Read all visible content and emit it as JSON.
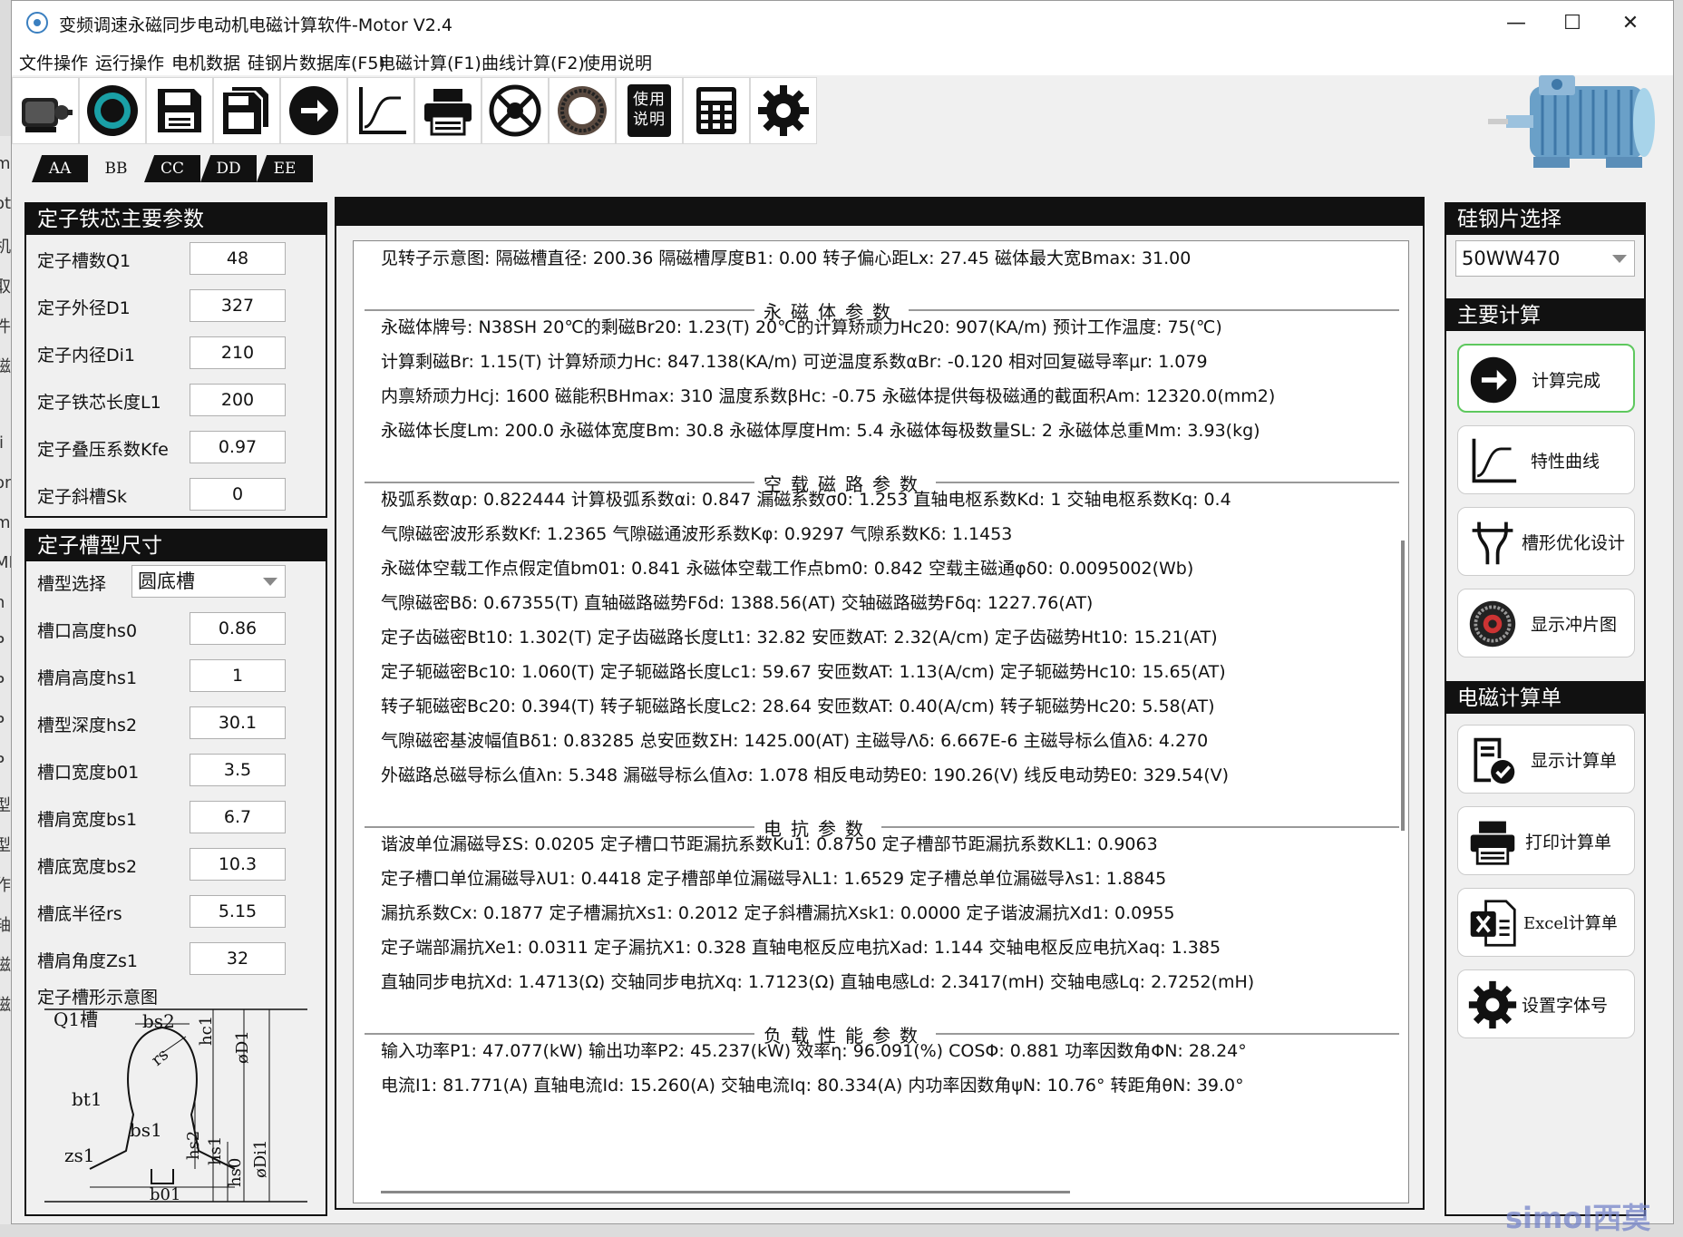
{
  "window": {
    "title": "变频调速永磁同步电动机电磁计算软件-Motor V2.4",
    "controls": [
      "—",
      "☐",
      "✕"
    ]
  },
  "menu": [
    "文件操作",
    "运行操作",
    "电机数据",
    "硅钢片数据库(F5)",
    "电磁计算(F1)",
    "曲线计算(F2)",
    "使用说明"
  ],
  "toolbar": {
    "icons": [
      "motor-icon",
      "stator-core-icon",
      "save-icon",
      "save-as-icon",
      "arrow-right-icon",
      "curve-icon",
      "printer-icon",
      "rotor-icon",
      "ring-icon",
      "manual-icon",
      "calculator-icon",
      "gear-icon"
    ],
    "manual_text": "使用说明"
  },
  "tabs": [
    "AA",
    "BB",
    "CC",
    "DD",
    "EE"
  ],
  "stator_core": {
    "title": "定子铁芯主要参数",
    "rows": [
      {
        "label": "定子槽数Q1",
        "value": "48"
      },
      {
        "label": "定子外径D1",
        "value": "327"
      },
      {
        "label": "定子内径Di1",
        "value": "210"
      },
      {
        "label": "定子铁芯长度L1",
        "value": "200"
      },
      {
        "label": "定子叠压系数Kfe",
        "value": "0.97"
      },
      {
        "label": "定子斜槽Sk",
        "value": "0"
      }
    ]
  },
  "slot": {
    "title": "定子槽型尺寸",
    "type_label": "槽型选择",
    "type_value": "圆底槽",
    "rows": [
      {
        "label": "槽口高度hs0",
        "value": "0.86"
      },
      {
        "label": "槽肩高度hs1",
        "value": "1"
      },
      {
        "label": "槽型深度hs2",
        "value": "30.1"
      },
      {
        "label": "槽口宽度b01",
        "value": "3.5"
      },
      {
        "label": "槽肩宽度bs1",
        "value": "6.7"
      },
      {
        "label": "槽底宽度bs2",
        "value": "10.3"
      },
      {
        "label": "槽底半径rs",
        "value": "5.15"
      },
      {
        "label": "槽肩角度Zs1",
        "value": "32"
      }
    ],
    "diagram_title": "定子槽形示意图",
    "diagram_labels": [
      "Q1槽",
      "bs2",
      "hc1",
      "øD1",
      "rs",
      "bt1",
      "bs1",
      "hs2",
      "hs1",
      "hs0",
      "øDi1",
      "zs1",
      "b01"
    ]
  },
  "results": {
    "lines": [
      {
        "type": "text",
        "text": "见转子示意图: 隔磁槽直径: 200.36 隔磁槽厚度B1: 0.00 转子偏心距Lx: 27.45 磁体最大宽Bmax: 31.00"
      },
      {
        "type": "section",
        "text": "永磁体参数"
      },
      {
        "type": "text",
        "text": "永磁体牌号: N38SH 20℃的剩磁Br20: 1.23(T) 20℃的计算矫顽力Hc20: 907(KA/m) 预计工作温度: 75(℃)"
      },
      {
        "type": "text",
        "text": "计算剩磁Br: 1.15(T) 计算矫顽力Hc: 847.138(KA/m) 可逆温度系数αBr: -0.120 相对回复磁导率μr: 1.079"
      },
      {
        "type": "text",
        "text": "内禀矫顽力Hcj: 1600 磁能积BHmax: 310 温度系数βHc: -0.75 永磁体提供每极磁通的截面积Am: 12320.0(mm2)"
      },
      {
        "type": "text",
        "text": "永磁体长度Lm: 200.0 永磁体宽度Bm: 30.8 永磁体厚度Hm: 5.4 永磁体每极数量SL: 2 永磁体总重Mm: 3.93(kg)"
      },
      {
        "type": "section",
        "text": "空载磁路参数"
      },
      {
        "type": "text",
        "text": "极弧系数αp: 0.822444 计算极弧系数αi: 0.847 漏磁系数σ0: 1.253 直轴电枢系数Kd: 1 交轴电枢系数Kq: 0.4"
      },
      {
        "type": "text",
        "text": "气隙磁密波形系数Kf: 1.2365 气隙磁通波形系数Kφ: 0.9297 气隙系数Kδ: 1.1453"
      },
      {
        "type": "text",
        "text": "永磁体空载工作点假定值bm01: 0.841 永磁体空载工作点bm0: 0.842 空载主磁通φδ0: 0.0095002(Wb)"
      },
      {
        "type": "text",
        "text": "气隙磁密Bδ: 0.67355(T) 直轴磁路磁势Fδd: 1388.56(AT) 交轴磁路磁势Fδq: 1227.76(AT)"
      },
      {
        "type": "text",
        "text": "定子齿磁密Bt10: 1.302(T) 定子齿磁路长度Lt1: 32.82 安匝数AT: 2.32(A/cm) 定子齿磁势Ht10: 15.21(AT)"
      },
      {
        "type": "text",
        "text": "定子轭磁密Bc10: 1.060(T) 定子轭磁路长度Lc1: 59.67 安匝数AT: 1.13(A/cm) 定子轭磁势Hc10: 15.65(AT)"
      },
      {
        "type": "text",
        "text": "转子轭磁密Bc20: 0.394(T) 转子轭磁路长度Lc2: 28.64 安匝数AT: 0.40(A/cm) 转子轭磁势Hc20: 5.58(AT)"
      },
      {
        "type": "text",
        "text": "气隙磁密基波幅值Bδ1: 0.83285 总安匝数ΣH: 1425.00(AT) 主磁导Λδ: 6.667E-6 主磁导标么值λδ: 4.270"
      },
      {
        "type": "text",
        "text": "外磁路总磁导标么值λn: 5.348 漏磁导标么值λσ: 1.078 相反电动势E0: 190.26(V) 线反电动势E0: 329.54(V)"
      },
      {
        "type": "section",
        "text": "电抗参数"
      },
      {
        "type": "text",
        "text": "谐波单位漏磁导ΣS: 0.0205 定子槽口节距漏抗系数Ku1: 0.8750 定子槽部节距漏抗系数KL1: 0.9063"
      },
      {
        "type": "text",
        "text": "定子槽口单位漏磁导λU1: 0.4418 定子槽部单位漏磁导λL1: 1.6529 定子槽总单位漏磁导λs1: 1.8845"
      },
      {
        "type": "text",
        "text": "漏抗系数Cx: 0.1877 定子槽漏抗Xs1: 0.2012 定子斜槽漏抗Xsk1: 0.0000 定子谐波漏抗Xd1: 0.0955"
      },
      {
        "type": "text",
        "text": "定子端部漏抗Xe1: 0.0311 定子漏抗X1: 0.328 直轴电枢反应电抗Xad: 1.144 交轴电枢反应电抗Xaq: 1.385"
      },
      {
        "type": "text",
        "text": "直轴同步电抗Xd: 1.4713(Ω) 交轴同步电抗Xq: 1.7123(Ω) 直轴电感Ld: 2.3417(mH) 交轴电感Lq: 2.7252(mH)"
      },
      {
        "type": "section",
        "text": "负载性能参数"
      },
      {
        "type": "text",
        "text": "输入功率P1: 47.077(kW) 输出功率P2: 45.237(kW) 效率η: 96.091(%) COSΦ: 0.881 功率因数角ΦN: 28.24°"
      },
      {
        "type": "text",
        "text": "电流I1: 81.771(A) 直轴电流Id: 15.260(A) 交轴电流Iq: 80.334(A) 内功率因数角ψN: 10.76° 转距角θN: 39.0°"
      }
    ]
  },
  "steel": {
    "title": "硅钢片选择",
    "value": "50WW470"
  },
  "main_calc": {
    "title": "主要计算",
    "buttons": [
      {
        "label": "计算完成",
        "icon": "arrow-right-icon"
      },
      {
        "label": "特性曲线",
        "icon": "curve-icon"
      },
      {
        "label": "槽形优化设计",
        "icon": "slot-design-icon"
      },
      {
        "label": "显示冲片图",
        "icon": "lamination-icon"
      }
    ]
  },
  "sheet": {
    "title": "电磁计算单",
    "buttons": [
      {
        "label": "显示计算单",
        "icon": "document-check-icon"
      },
      {
        "label": "打印计算单",
        "icon": "printer-icon"
      },
      {
        "label": "Excel计算单",
        "icon": "excel-icon"
      },
      {
        "label": "设置字体号",
        "icon": "gear-icon"
      }
    ]
  },
  "left_strip": [
    "m",
    "ot",
    "机",
    "取",
    "件",
    "磁",
    "I",
    "li",
    "on",
    "m",
    "MI",
    "n",
    "P",
    "P",
    "P",
    "P",
    "型",
    "型",
    "作",
    "轴",
    "磁",
    "磁"
  ],
  "watermark": "simol西莫"
}
